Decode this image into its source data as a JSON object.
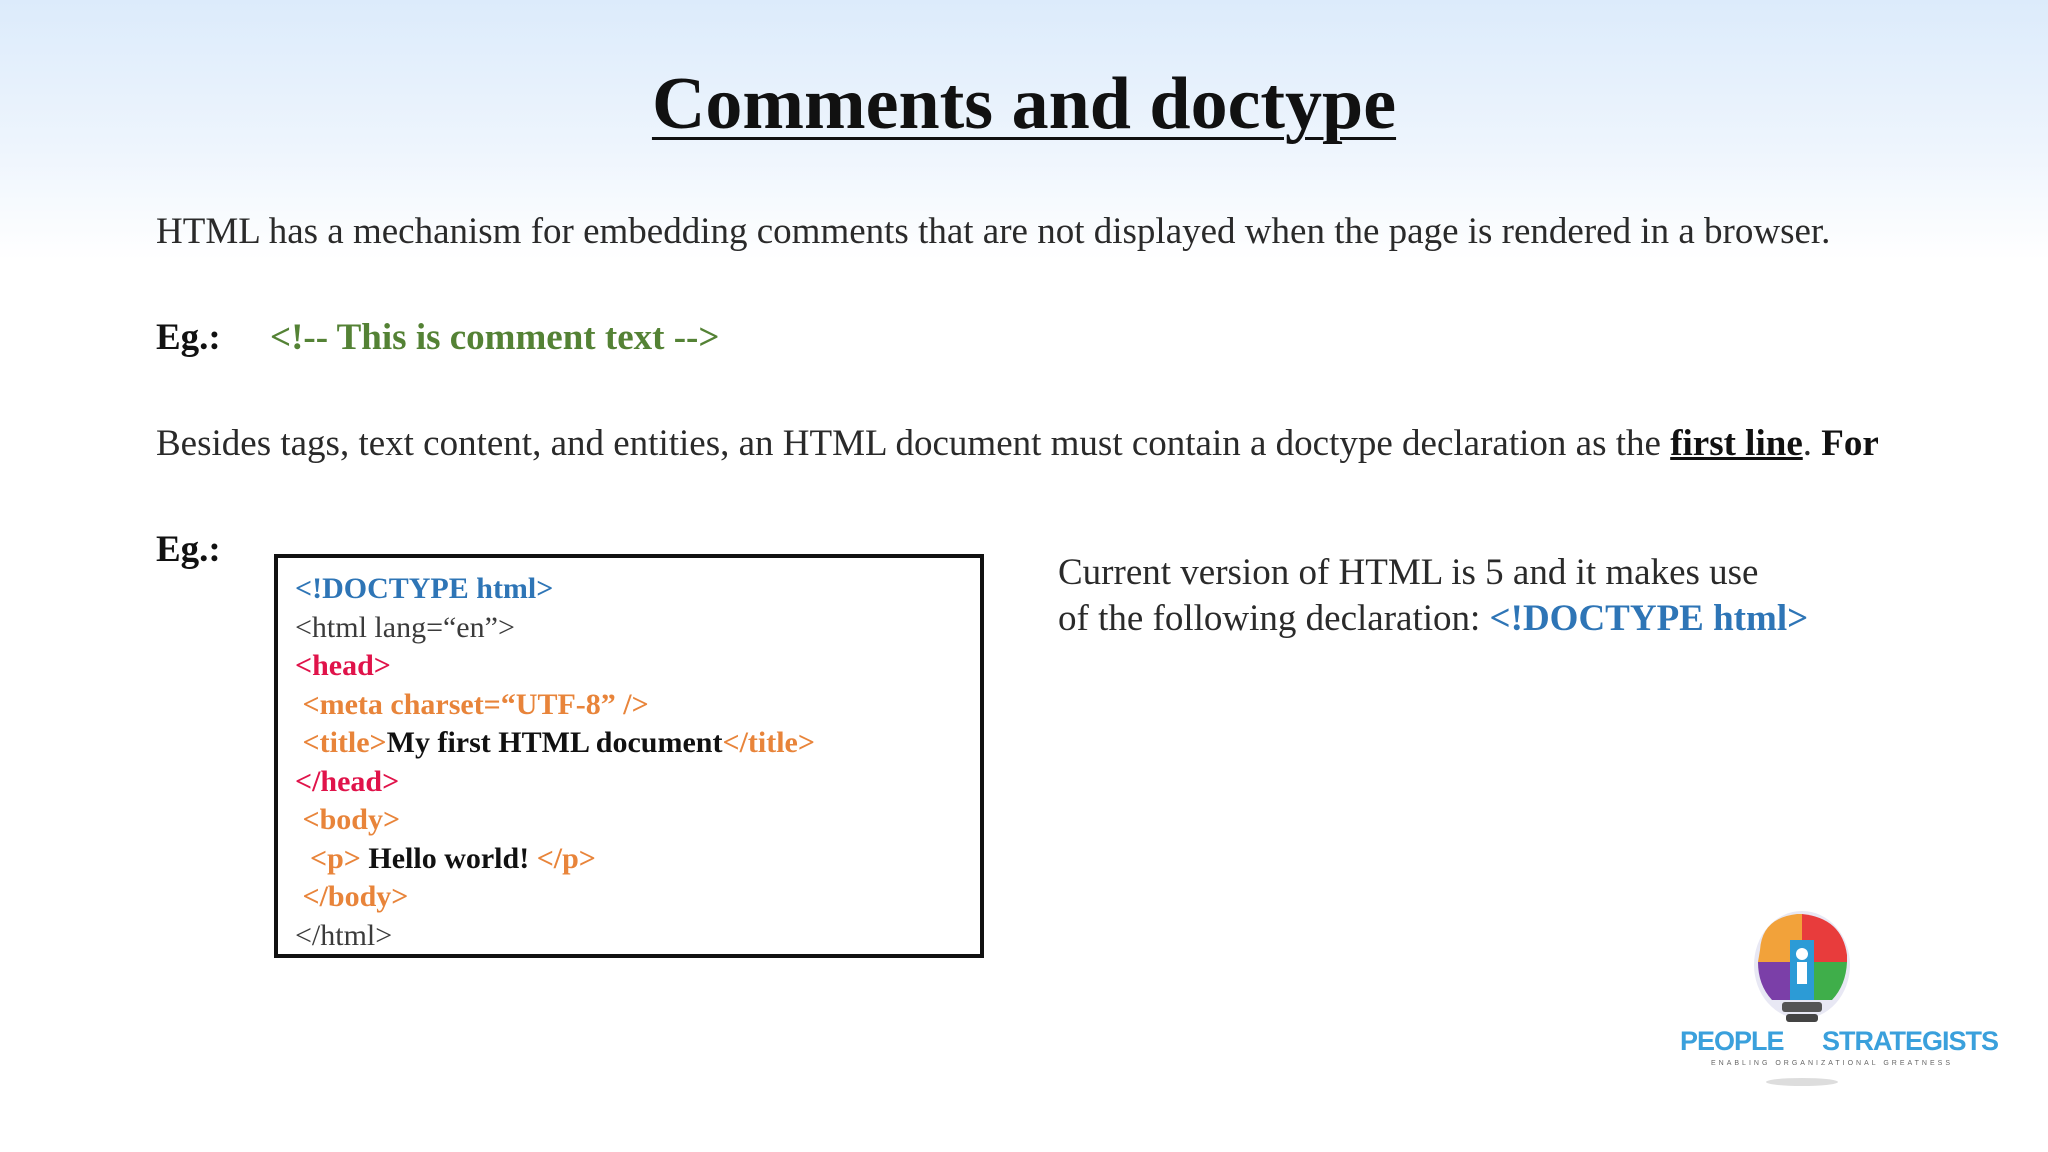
{
  "title": "Comments and doctype",
  "para1": "HTML has a mechanism for embedding comments that are not displayed when the page is rendered in a browser.",
  "eg_label": "Eg.:",
  "comment_example": "<!-- This is comment text -->",
  "para2": {
    "before": "Besides tags, text content, and entities, an HTML document must contain a doctype declaration as the ",
    "emphasis": "first line",
    "after": ". ",
    "trailing": "For"
  },
  "code_lines": [
    {
      "parts": [
        {
          "text": "<!DOCTYPE html>",
          "style": "doctype"
        }
      ]
    },
    {
      "parts": [
        {
          "text": "<html lang=“en”>",
          "style": "gray"
        }
      ]
    },
    {
      "parts": [
        {
          "text": "<head>",
          "style": "red"
        }
      ]
    },
    {
      "parts": [
        {
          "text": " <meta charset=“UTF-8” />",
          "style": "orange"
        }
      ]
    },
    {
      "parts": [
        {
          "text": " <title>",
          "style": "orange"
        },
        {
          "text": "My first HTML document",
          "style": "black"
        },
        {
          "text": "</title>",
          "style": "orange"
        }
      ]
    },
    {
      "parts": [
        {
          "text": "</head>",
          "style": "red"
        }
      ]
    },
    {
      "parts": [
        {
          "text": " <body>",
          "style": "orange"
        }
      ]
    },
    {
      "parts": [
        {
          "text": "  <p>",
          "style": "orange"
        },
        {
          "text": " Hello world! ",
          "style": "black"
        },
        {
          "text": "</p>",
          "style": "orange"
        }
      ]
    },
    {
      "parts": [
        {
          "text": " </body>",
          "style": "orange"
        }
      ]
    },
    {
      "parts": [
        {
          "text": "</html>",
          "style": "gray"
        }
      ]
    }
  ],
  "side": {
    "line1": "Current version of HTML is 5 and it makes use",
    "line2": "of the following declaration: ",
    "doctype": "<!DOCTYPE html>"
  },
  "logo": {
    "left_word": "PEOPLE",
    "right_word": "STRATEGISTS",
    "tagline": "ENABLING ORGANIZATIONAL GREATNESS",
    "icon": "lightbulb-puzzle-icon"
  },
  "colors": {
    "comment_green": "#548235",
    "doctype_blue": "#2e75b6",
    "tag_red": "#e0134a",
    "tag_orange": "#e8843a",
    "logo_blue": "#3aa0dc"
  }
}
